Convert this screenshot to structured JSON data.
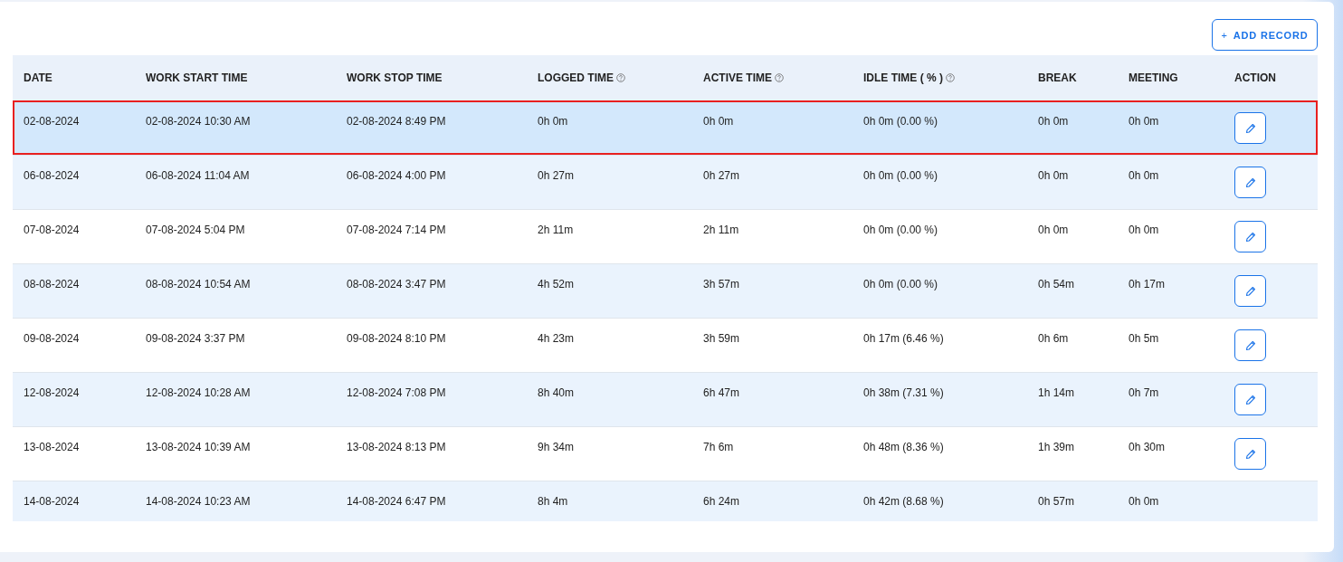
{
  "add_button": {
    "icon": "+",
    "label": "ADD RECORD"
  },
  "table": {
    "columns": [
      {
        "label": "DATE",
        "help": false
      },
      {
        "label": "WORK START TIME",
        "help": false
      },
      {
        "label": "WORK STOP TIME",
        "help": false
      },
      {
        "label": "LOGGED TIME",
        "help": true
      },
      {
        "label": "ACTIVE TIME",
        "help": true
      },
      {
        "label": "IDLE TIME ( % )",
        "help": true
      },
      {
        "label": "BREAK",
        "help": false
      },
      {
        "label": "MEETING",
        "help": false
      },
      {
        "label": "ACTION",
        "help": false
      }
    ],
    "rows": [
      {
        "selected": true,
        "editable": true,
        "cells": [
          "02-08-2024",
          "02-08-2024 10:30 AM",
          "02-08-2024 8:49 PM",
          "0h 0m",
          "0h 0m",
          "0h 0m (0.00 %)",
          "0h 0m",
          "0h 0m"
        ]
      },
      {
        "selected": false,
        "editable": true,
        "cells": [
          "06-08-2024",
          "06-08-2024 11:04 AM",
          "06-08-2024 4:00 PM",
          "0h 27m",
          "0h 27m",
          "0h 0m (0.00 %)",
          "0h 0m",
          "0h 0m"
        ]
      },
      {
        "selected": false,
        "editable": true,
        "cells": [
          "07-08-2024",
          "07-08-2024 5:04 PM",
          "07-08-2024 7:14 PM",
          "2h 11m",
          "2h 11m",
          "0h 0m (0.00 %)",
          "0h 0m",
          "0h 0m"
        ]
      },
      {
        "selected": false,
        "editable": true,
        "cells": [
          "08-08-2024",
          "08-08-2024 10:54 AM",
          "08-08-2024 3:47 PM",
          "4h 52m",
          "3h 57m",
          "0h 0m (0.00 %)",
          "0h 54m",
          "0h 17m"
        ]
      },
      {
        "selected": false,
        "editable": true,
        "cells": [
          "09-08-2024",
          "09-08-2024 3:37 PM",
          "09-08-2024 8:10 PM",
          "4h 23m",
          "3h 59m",
          "0h 17m (6.46 %)",
          "0h 6m",
          "0h 5m"
        ]
      },
      {
        "selected": false,
        "editable": true,
        "cells": [
          "12-08-2024",
          "12-08-2024 10:28 AM",
          "12-08-2024 7:08 PM",
          "8h 40m",
          "6h 47m",
          "0h 38m (7.31 %)",
          "1h 14m",
          "0h 7m"
        ]
      },
      {
        "selected": false,
        "editable": true,
        "cells": [
          "13-08-2024",
          "13-08-2024 10:39 AM",
          "13-08-2024 8:13 PM",
          "9h 34m",
          "7h 6m",
          "0h 48m (8.36 %)",
          "1h 39m",
          "0h 30m"
        ]
      },
      {
        "selected": false,
        "editable": false,
        "cells": [
          "14-08-2024",
          "14-08-2024 10:23 AM",
          "14-08-2024 6:47 PM",
          "8h 4m",
          "6h 24m",
          "0h 42m (8.68 %)",
          "0h 57m",
          "0h 0m"
        ]
      }
    ]
  }
}
